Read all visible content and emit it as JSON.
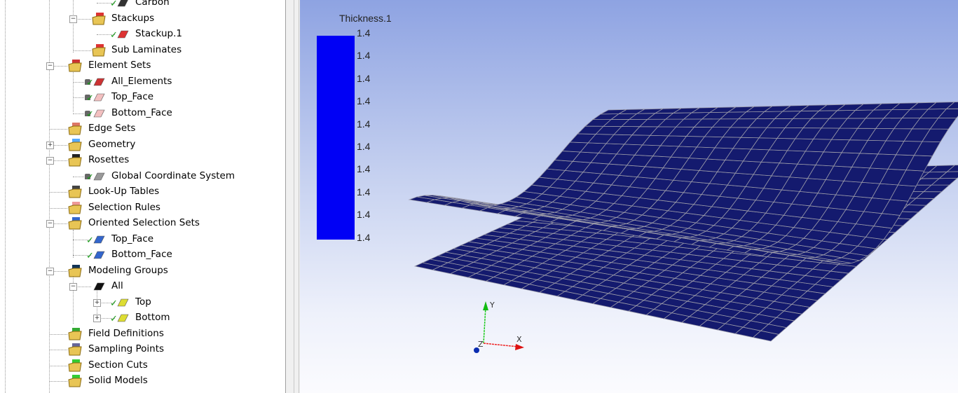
{
  "tree": {
    "items": [
      {
        "label": "Carbon",
        "level": 3,
        "check": true,
        "icon": "fabric-icon",
        "color": "#333"
      },
      {
        "label": "Stackups",
        "level": 2,
        "expander": "minus",
        "icon": "stackups-folder-icon",
        "color": "#d33"
      },
      {
        "label": "Stackup.1",
        "level": 3,
        "check": true,
        "icon": "stackup-icon",
        "color": "#d33"
      },
      {
        "label": "Sub Laminates",
        "level": 2,
        "icon": "sub-laminates-folder-icon",
        "color": "#d33"
      },
      {
        "label": "Element Sets",
        "level": 1,
        "expander": "minus",
        "icon": "element-sets-folder-icon",
        "color": "#c33"
      },
      {
        "label": "All_Elements",
        "level": 2,
        "check": true,
        "lock": true,
        "icon": "element-set-icon",
        "color": "#c33"
      },
      {
        "label": "Top_Face",
        "level": 2,
        "check": true,
        "lock": true,
        "icon": "element-set-icon",
        "color": "#f3c0c0"
      },
      {
        "label": "Bottom_Face",
        "level": 2,
        "check": true,
        "lock": true,
        "icon": "element-set-icon",
        "color": "#f3c0c0"
      },
      {
        "label": "Edge Sets",
        "level": 1,
        "icon": "edge-sets-folder-icon",
        "color": "#d76"
      },
      {
        "label": "Geometry",
        "level": 1,
        "expander": "plus",
        "icon": "geometry-folder-icon",
        "color": "#5af"
      },
      {
        "label": "Rosettes",
        "level": 1,
        "expander": "minus",
        "icon": "rosettes-folder-icon",
        "color": "#222"
      },
      {
        "label": "Global Coordinate System",
        "level": 2,
        "check": true,
        "lock": true,
        "icon": "coordinate-system-icon",
        "color": "#999"
      },
      {
        "label": "Look-Up Tables",
        "level": 1,
        "icon": "lookup-tables-folder-icon",
        "color": "#444"
      },
      {
        "label": "Selection Rules",
        "level": 1,
        "icon": "selection-rules-folder-icon",
        "color": "#e99"
      },
      {
        "label": "Oriented Selection Sets",
        "level": 1,
        "expander": "minus",
        "icon": "oriented-selection-sets-folder-icon",
        "color": "#36c"
      },
      {
        "label": "Top_Face",
        "level": 2,
        "check": true,
        "icon": "oriented-selection-set-icon",
        "color": "#36c"
      },
      {
        "label": "Bottom_Face",
        "level": 2,
        "check": true,
        "icon": "oriented-selection-set-icon",
        "color": "#36c"
      },
      {
        "label": "Modeling Groups",
        "level": 1,
        "expander": "minus",
        "icon": "modeling-groups-folder-icon",
        "color": "#135"
      },
      {
        "label": "All",
        "level": 2,
        "expander": "minus",
        "icon": "modeling-group-icon",
        "color": "#111"
      },
      {
        "label": "Top",
        "level": 3,
        "expander": "plus",
        "check": true,
        "icon": "ply-icon",
        "color": "#dd3"
      },
      {
        "label": "Bottom",
        "level": 3,
        "expander": "plus",
        "check": true,
        "icon": "ply-icon",
        "color": "#dd3"
      },
      {
        "label": "Field Definitions",
        "level": 1,
        "icon": "field-definitions-folder-icon",
        "color": "#3a3"
      },
      {
        "label": "Sampling Points",
        "level": 1,
        "icon": "sampling-points-folder-icon",
        "color": "#669"
      },
      {
        "label": "Section Cuts",
        "level": 1,
        "icon": "section-cuts-folder-icon",
        "color": "#3c3"
      },
      {
        "label": "Solid Models",
        "level": 1,
        "icon": "solid-models-folder-icon",
        "color": "#3c3"
      }
    ]
  },
  "viewport": {
    "legend_title": "Thickness.1",
    "legend_values": [
      "1.4",
      "1.4",
      "1.4",
      "1.4",
      "1.4",
      "1.4",
      "1.4",
      "1.4",
      "1.4",
      "1.4"
    ],
    "legend_color": "#0000f5",
    "mesh_color": "#141a6e",
    "triad": {
      "x": "X",
      "y": "Y",
      "z": "Z"
    }
  }
}
